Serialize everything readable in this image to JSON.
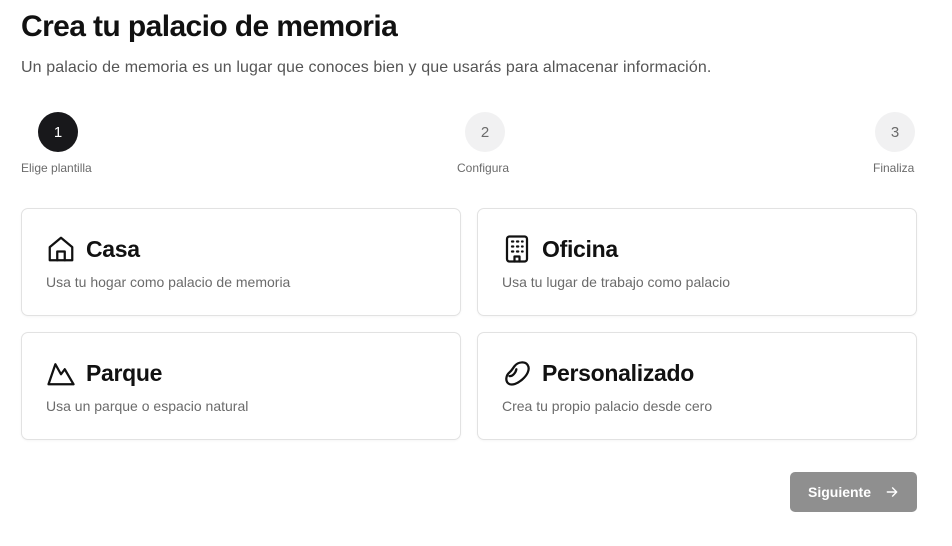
{
  "header": {
    "title": "Crea tu palacio de memoria",
    "subtitle": "Un palacio de memoria es un lugar que conoces bien y que usarás para almacenar información."
  },
  "stepper": {
    "current_step": 1,
    "steps": [
      {
        "number": "1",
        "label": "Elige plantilla",
        "state": "active"
      },
      {
        "number": "2",
        "label": "Configura",
        "state": "pending"
      },
      {
        "number": "3",
        "label": "Finaliza",
        "state": "pending"
      }
    ]
  },
  "templates": [
    {
      "icon": "house-icon",
      "title": "Casa",
      "description": "Usa tu hogar como palacio de memoria"
    },
    {
      "icon": "building-icon",
      "title": "Oficina",
      "description": "Usa tu lugar de trabajo como palacio"
    },
    {
      "icon": "mountain-icon",
      "title": "Parque",
      "description": "Usa un parque o espacio natural"
    },
    {
      "icon": "bean-icon",
      "title": "Personalizado",
      "description": "Crea tu propio palacio desde cero"
    }
  ],
  "footer": {
    "next_label": "Siguiente",
    "next_icon": "arrow-right-icon",
    "next_disabled": true
  },
  "colors": {
    "active_step": "#18181b",
    "inactive_step": "#f1f1f2",
    "button_disabled": "#8f8f8f",
    "card_border": "#e2e2e2"
  }
}
